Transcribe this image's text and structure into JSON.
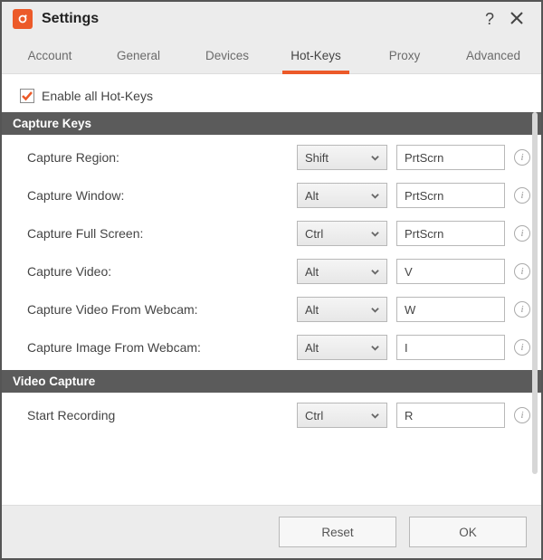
{
  "title": "Settings",
  "tabs": [
    "Account",
    "General",
    "Devices",
    "Hot-Keys",
    "Proxy",
    "Advanced"
  ],
  "active_tab": 3,
  "enable_all_label": "Enable all Hot-Keys",
  "enable_all_checked": true,
  "sections": {
    "capture_keys": {
      "header": "Capture Keys",
      "rows": [
        {
          "label": "Capture Region:",
          "modifier": "Shift",
          "key": "PrtScrn"
        },
        {
          "label": "Capture Window:",
          "modifier": "Alt",
          "key": "PrtScrn"
        },
        {
          "label": "Capture Full Screen:",
          "modifier": "Ctrl",
          "key": "PrtScrn"
        },
        {
          "label": "Capture Video:",
          "modifier": "Alt",
          "key": "V"
        },
        {
          "label": "Capture Video From Webcam:",
          "modifier": "Alt",
          "key": "W"
        },
        {
          "label": "Capture Image From Webcam:",
          "modifier": "Alt",
          "key": "I"
        }
      ]
    },
    "video_capture": {
      "header": "Video Capture",
      "rows": [
        {
          "label": "Start Recording",
          "modifier": "Ctrl",
          "key": "R"
        }
      ]
    }
  },
  "footer": {
    "reset": "Reset",
    "ok": "OK"
  },
  "info_tooltip": "i"
}
